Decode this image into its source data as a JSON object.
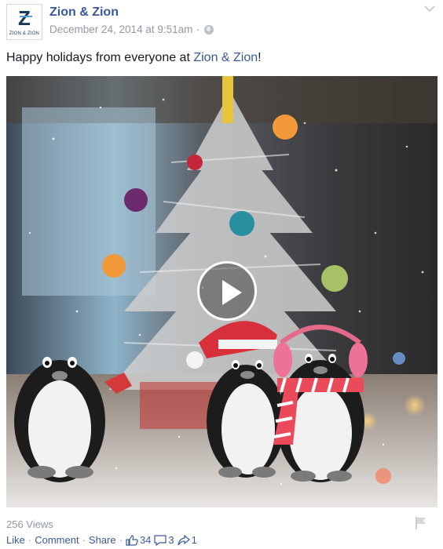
{
  "page": {
    "name": "Zion & Zion",
    "avatar_letter": "Z",
    "avatar_text": "ZION & ZION",
    "timestamp": "December 24, 2014 at 9:51am",
    "separator": "·"
  },
  "post": {
    "message_prefix": "Happy holidays from everyone at ",
    "message_link": "Zion & Zion",
    "message_suffix": "!"
  },
  "video": {
    "views": "256 Views"
  },
  "actions": {
    "like": "Like",
    "comment": "Comment",
    "share": "Share",
    "separator": "·",
    "likes_count": "34",
    "comments_count": "3",
    "shares_count": "1"
  },
  "colors": {
    "link": "#3b5998",
    "muted": "#9197a3",
    "text": "#141823"
  },
  "icons": [
    "globe-icon",
    "chevron-down-icon",
    "play-icon",
    "flag-icon",
    "thumbs-up-icon",
    "comment-icon",
    "share-icon"
  ]
}
